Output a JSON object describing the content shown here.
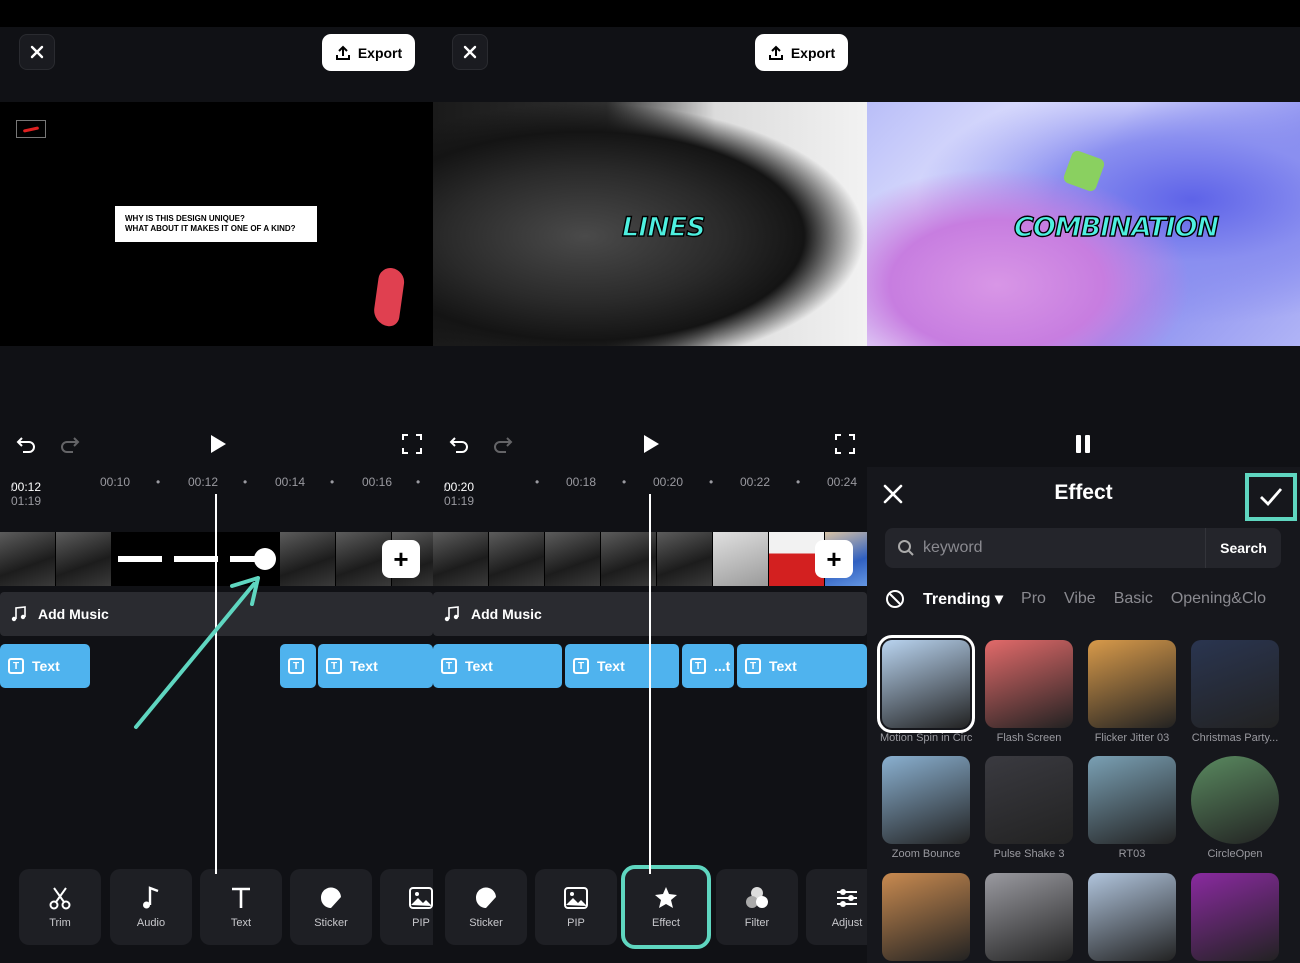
{
  "export_label": "Export",
  "panel1": {
    "caption_text": "WHY IS THIS DESIGN UNIQUE?\nWHAT ABOUT IT MAKES IT ONE OF A KIND?",
    "time_current": "00:12",
    "time_total": " / 01:19",
    "ticks": [
      "00:10",
      "00:12",
      "00:14",
      "00:16"
    ],
    "add_music": "Add Music",
    "text_blocks": [
      "Text",
      "",
      "Text"
    ],
    "tools": [
      "Trim",
      "Audio",
      "Text",
      "Sticker",
      "PIP"
    ]
  },
  "panel2": {
    "overlay_word": "LINES",
    "time_current": "00:20",
    "time_total": " / 01:19",
    "ticks": [
      "00:18",
      "00:20",
      "00:22",
      "00:24"
    ],
    "add_music": "Add Music",
    "text_blocks": [
      "Text",
      "Text",
      "...t",
      "Text"
    ],
    "tools": [
      "Sticker",
      "PIP",
      "Effect",
      "Filter",
      "Adjust"
    ]
  },
  "panel3": {
    "overlay_word": "COMBINATION",
    "title": "Effect",
    "search_placeholder": "keyword",
    "search_button": "Search",
    "categories": [
      "Trending",
      "Pro",
      "Vibe",
      "Basic",
      "Opening&Clo"
    ],
    "effects": [
      {
        "label": "Motion Spin in Circ",
        "color": "#b9d4f0"
      },
      {
        "label": "Flash Screen",
        "color": "#e26a6a"
      },
      {
        "label": "Flicker Jitter 03",
        "color": "#d89a4a"
      },
      {
        "label": "Christmas Party...",
        "color": "#2a3550"
      },
      {
        "label": "Zoom Bounce",
        "color": "#8ab0d0"
      },
      {
        "label": "Pulse Shake 3",
        "color": "#3a3a40"
      },
      {
        "label": "RT03",
        "color": "#7aa0b4"
      },
      {
        "label": "CircleOpen",
        "color": "#5a8a60"
      },
      {
        "label": "",
        "color": "#c88a50"
      },
      {
        "label": "",
        "color": "#9a9aa0"
      },
      {
        "label": "",
        "color": "#b0c4dc"
      },
      {
        "label": "",
        "color": "#8a2aa0"
      }
    ]
  },
  "colors": {
    "accent": "#5fd6c0",
    "text_block": "#4fb3ee"
  }
}
